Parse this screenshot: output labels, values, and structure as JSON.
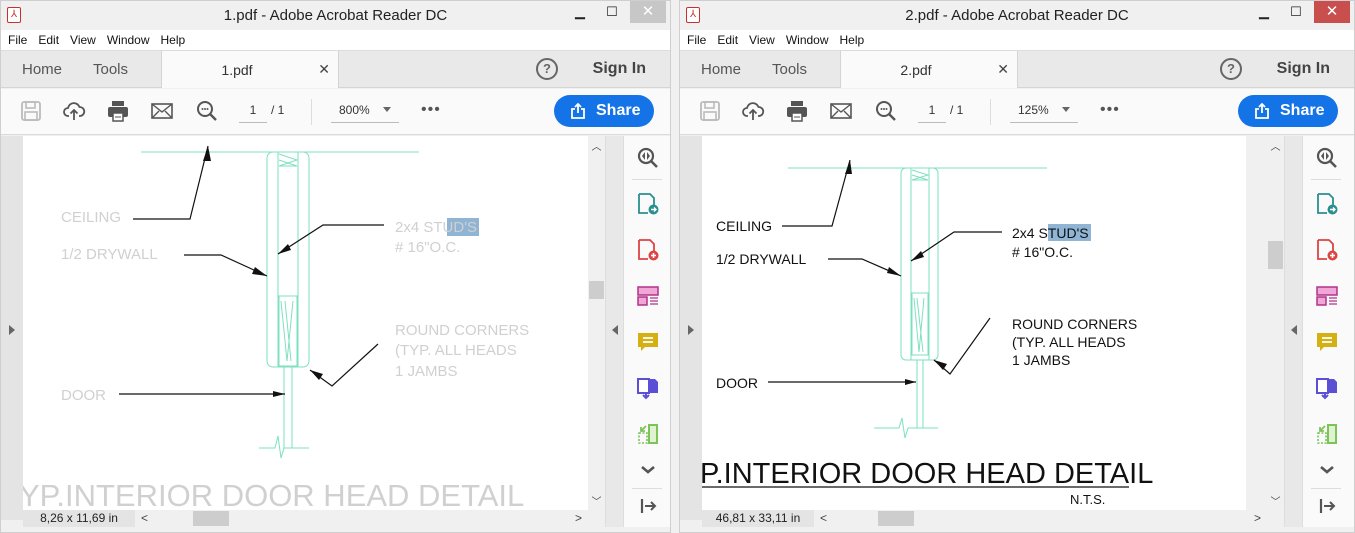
{
  "windows": [
    {
      "title": "1.pdf - Adobe Acrobat Reader DC",
      "menu": [
        "File",
        "Edit",
        "View",
        "Window",
        "Help"
      ],
      "tabs": {
        "home": "Home",
        "tools": "Tools",
        "doc": "1.pdf"
      },
      "sign_in": "Sign In",
      "help_icon": "?",
      "page": {
        "current": "1",
        "total": "/ 1"
      },
      "zoom": "800%",
      "share": "Share",
      "page_size": "8,26 x 11,69 in",
      "drawing": {
        "ceiling": "CEILING",
        "drywall": "1/2 DRYWALL",
        "studs_pre": "2x4 S",
        "studs_sel": "TUD",
        "studs_post": "'S",
        "studs_line2": "# 16\"O.C.",
        "corners_1": "ROUND CORNERS",
        "corners_2": "(TYP. ALL HEADS",
        "corners_3": "1 JAMBS",
        "door": "DOOR",
        "title": "YP.INTERIOR  DOOR  HEAD  DETAIL"
      },
      "scroll": {
        "vertical_position": 0.4,
        "horizontal_position": 0.14
      },
      "text_color": "#d0d0d0"
    },
    {
      "title": "2.pdf - Adobe Acrobat Reader DC",
      "menu": [
        "File",
        "Edit",
        "View",
        "Window",
        "Help"
      ],
      "tabs": {
        "home": "Home",
        "tools": "Tools",
        "doc": "2.pdf"
      },
      "sign_in": "Sign In",
      "help_icon": "?",
      "page": {
        "current": "1",
        "total": "/ 1"
      },
      "zoom": "125%",
      "share": "Share",
      "page_size": "46,81 x 33,11 in",
      "drawing": {
        "ceiling": "CEILING",
        "drywall": "1/2 DRYWALL",
        "studs_pre": "2x4 ",
        "studs_sel": "STUD",
        "studs_post": "'S",
        "studs_line2": "# 16\"O.C.",
        "corners_1": "ROUND CORNERS",
        "corners_2": "(TYP. ALL HEADS",
        "corners_3": "1 JAMBS",
        "door": "DOOR",
        "title": "P.INTERIOR  DOOR  HEAD  DETAIL",
        "nts": "N.T.S."
      },
      "scroll": {
        "vertical_position": 0.3,
        "horizontal_position": 0.14
      },
      "text_color": "#111111"
    }
  ],
  "colors": {
    "accent": "#1473e6",
    "drawing_lines": "#7ee0c0",
    "selection": "#8fb4d4"
  },
  "right_panel_icons": [
    "zoom-tool-icon",
    "export-pdf-icon",
    "create-pdf-icon",
    "organize-pages-icon",
    "comment-icon",
    "combine-files-icon",
    "compress-icon",
    "expand-more-icon",
    "collapse-panel-icon"
  ]
}
